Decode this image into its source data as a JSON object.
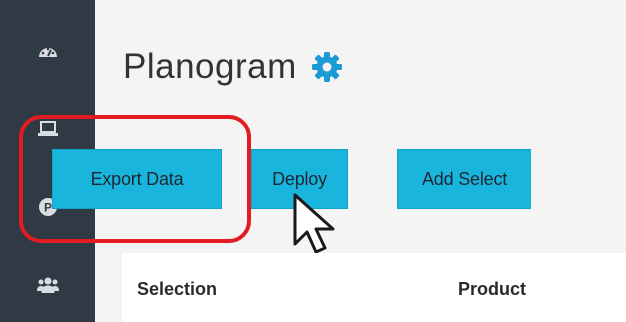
{
  "sidebar": {
    "items": [
      {
        "icon": "dashboard-gauge-icon"
      },
      {
        "icon": "laptop-icon"
      },
      {
        "icon": "parking-p-icon"
      },
      {
        "icon": "users-group-icon"
      }
    ]
  },
  "header": {
    "title": "Planogram",
    "settings_icon": "gear-icon"
  },
  "toolbar": {
    "export_label": "Export Data",
    "deploy_label": "Deploy",
    "add_label": "Add Select"
  },
  "table": {
    "columns": [
      "Selection",
      "Product"
    ]
  },
  "colors": {
    "sidebar": "#2f3a45",
    "button": "#19b5dd",
    "highlight": "#e31b23",
    "gear": "#1c9ad6"
  }
}
